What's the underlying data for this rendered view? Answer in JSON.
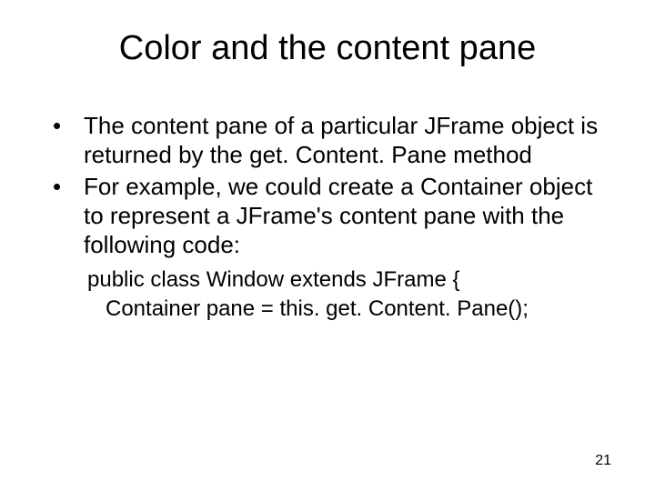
{
  "title": "Color and the content pane",
  "bullets": [
    "The content pane of a particular JFrame object is returned by the get. Content. Pane method",
    "For example, we could create a Container object to represent a JFrame's content pane with the following code:"
  ],
  "code": {
    "line1": "public class Window extends JFrame {",
    "line2": "Container pane = this. get. Content. Pane();"
  },
  "page_number": "21"
}
